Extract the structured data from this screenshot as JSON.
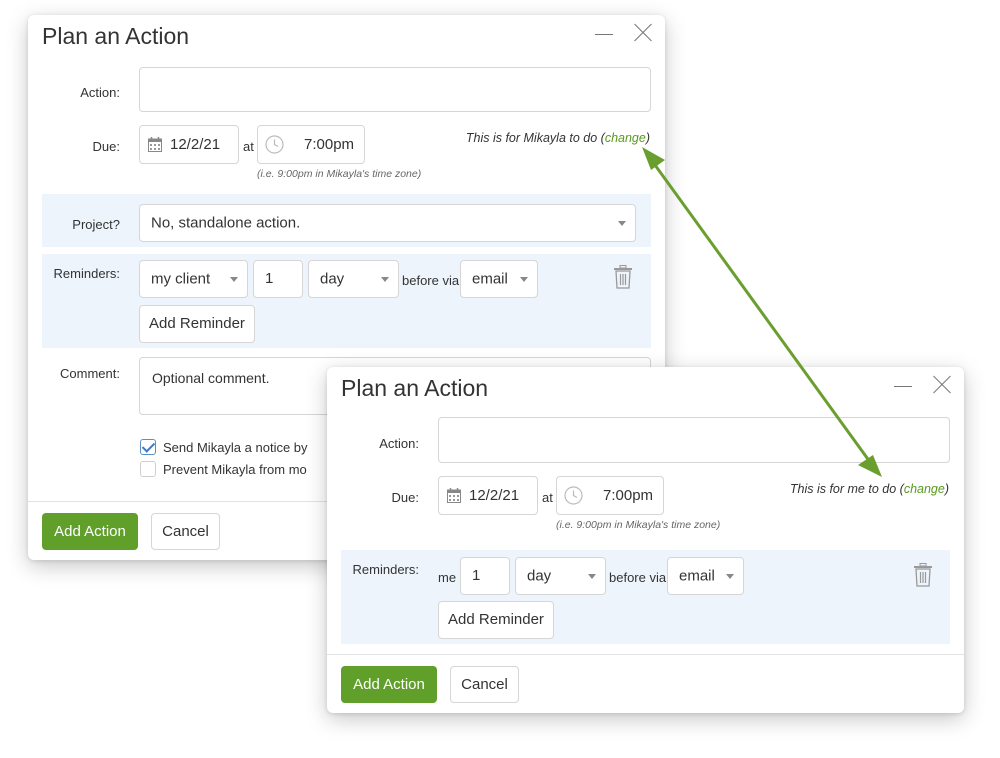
{
  "dialog1": {
    "title": "Plan an Action",
    "action_label": "Action:",
    "action_value": "",
    "due_label": "Due:",
    "due_date": "12/2/21",
    "at_label": "at",
    "due_time": "7:00pm",
    "timezone_hint": "(i.e. 9:00pm in Mikayla's time zone)",
    "assignee_prefix": "This is for Mikayla to do (",
    "change_link": "change",
    "assignee_suffix": ")",
    "project_label": "Project?",
    "project_value": "No, standalone action.",
    "reminders_label": "Reminders:",
    "reminder": {
      "who": "my client",
      "count": "1",
      "unit": "day",
      "before_via": "before via",
      "channel": "email"
    },
    "add_reminder": "Add Reminder",
    "comment_label": "Comment:",
    "comment_placeholder": "Optional comment.",
    "notice_checkbox_label": "Send Mikayla a notice by",
    "notice_checked": true,
    "prevent_checkbox_label": "Prevent Mikayla from mo",
    "prevent_checked": false,
    "add_action": "Add Action",
    "cancel": "Cancel"
  },
  "dialog2": {
    "title": "Plan an Action",
    "action_label": "Action:",
    "action_value": "",
    "due_label": "Due:",
    "due_date": "12/2/21",
    "at_label": "at",
    "due_time": "7:00pm",
    "timezone_hint": "(i.e. 9:00pm in Mikayla's time zone)",
    "assignee_prefix": "This is for me to do (",
    "change_link": "change",
    "assignee_suffix": ")",
    "reminders_label": "Reminders:",
    "reminder": {
      "who": "me",
      "count": "1",
      "unit": "day",
      "before_via": "before via",
      "channel": "email"
    },
    "add_reminder": "Add Reminder",
    "add_action": "Add Action",
    "cancel": "Cancel"
  },
  "colors": {
    "primary_green": "#5f9f2a",
    "link_green": "#5a9a1e",
    "arrow_green": "#6a9e2f",
    "band_blue": "#eef4fb"
  },
  "icons": [
    "calendar-icon",
    "clock-icon",
    "trash-icon",
    "chevron-down-icon",
    "minimize-icon",
    "close-icon",
    "checkmark-icon",
    "double-arrow-icon"
  ]
}
